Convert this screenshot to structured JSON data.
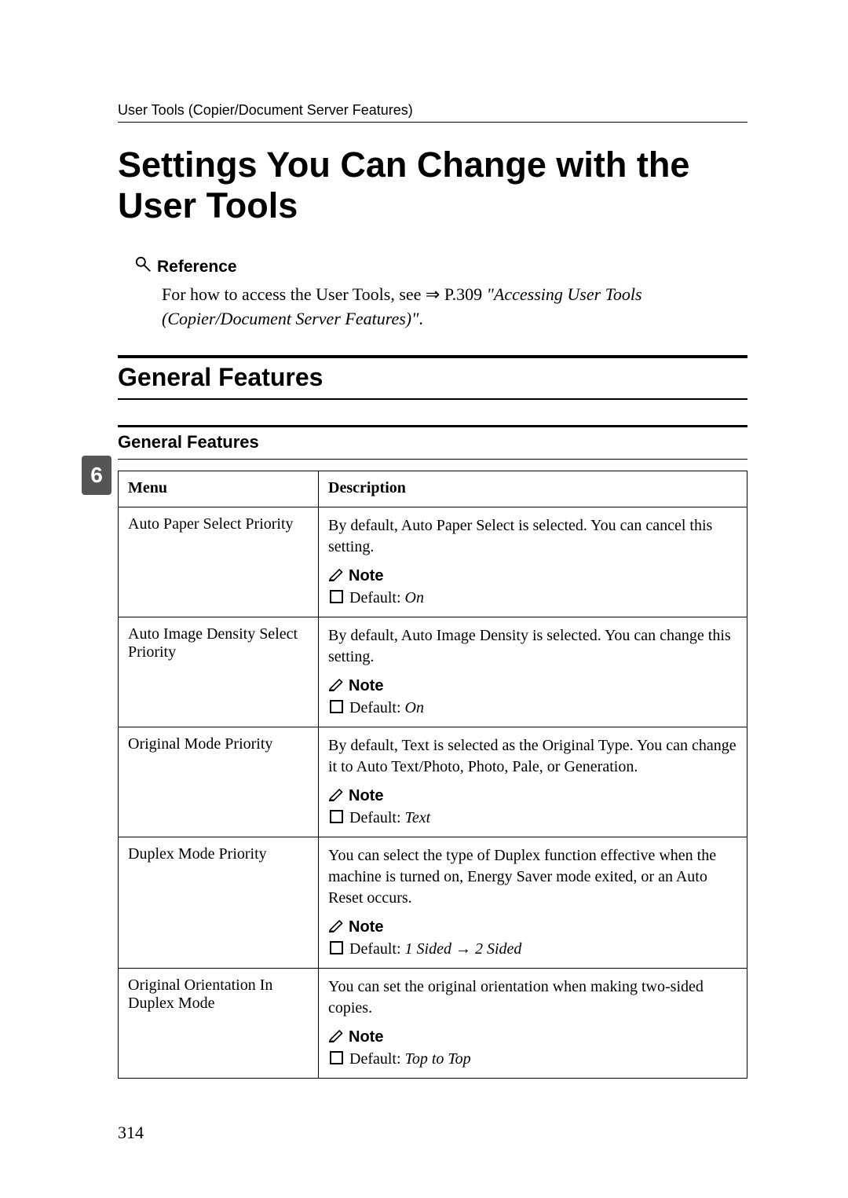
{
  "header": "User Tools (Copier/Document Server Features)",
  "title": "Settings You Can Change with the User Tools",
  "reference_label": "Reference",
  "reference_text_1": "For how to access the User Tools, see ⇒ P.309 ",
  "reference_text_2": "\"Accessing User Tools (Copier/Document Server Features)\"",
  "reference_text_3": ".",
  "section_general": "General Features",
  "subsection_general": "General Features",
  "table": {
    "col_menu": "Menu",
    "col_desc": "Description",
    "rows": [
      {
        "menu": "Auto Paper Select Priority",
        "desc": "By default, Auto Paper Select is selected. You can cancel this setting.",
        "note": "Note",
        "default_label": "Default: ",
        "default_val": "On"
      },
      {
        "menu": "Auto Image Density Select Priority",
        "desc": "By default, Auto Image Density is selected. You can change this setting.",
        "note": "Note",
        "default_label": "Default: ",
        "default_val": "On"
      },
      {
        "menu": "Original Mode Priority",
        "desc": "By default, Text is selected as the Original Type. You can change it to Auto Text/Photo, Photo, Pale, or Generation.",
        "note": "Note",
        "default_label": "Default: ",
        "default_val": "Text"
      },
      {
        "menu": "Duplex Mode Priority",
        "desc": "You can select the type of Duplex function effective when the machine is turned on, Energy Saver mode exited, or an Auto Reset occurs.",
        "note": "Note",
        "default_label": "Default: ",
        "default_val": "1 Sided → 2 Sided"
      },
      {
        "menu": "Original Orientation In Duplex Mode",
        "desc": "You can set the original orientation when making two-sided copies.",
        "note": "Note",
        "default_label": "Default: ",
        "default_val": "Top to Top"
      }
    ]
  },
  "side_tab": "6",
  "page_number": "314"
}
